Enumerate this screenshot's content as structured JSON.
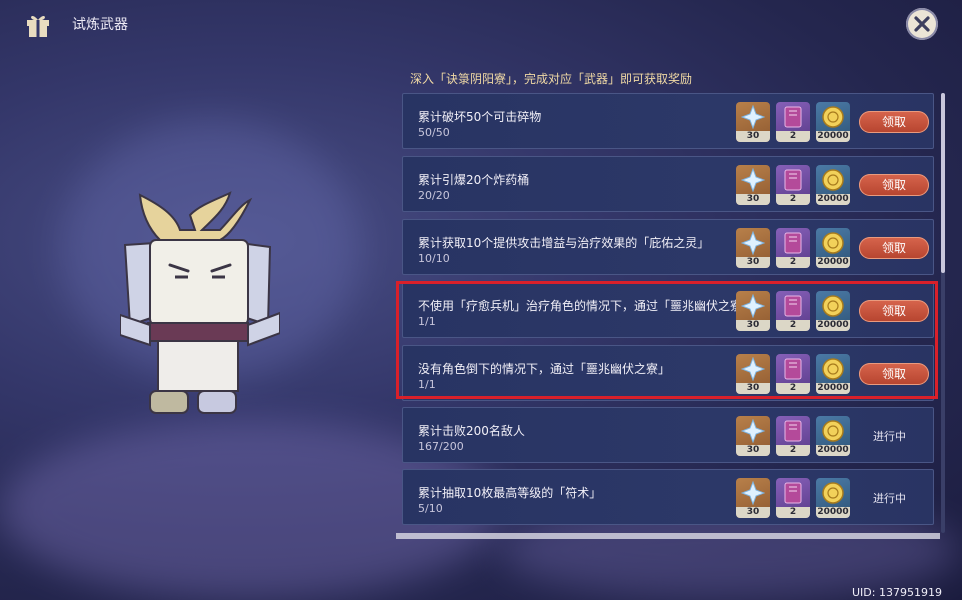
{
  "header": {
    "title": "试炼武器"
  },
  "subtitle": "深入「诀箓阴阳寮」，完成对应「武器」即可获取奖励",
  "tasks": [
    {
      "title": "累计破坏50个可击碎物",
      "progress": "50/50",
      "rewards": [
        "30",
        "2",
        "20000"
      ],
      "action": "领取"
    },
    {
      "title": "累计引爆20个炸药桶",
      "progress": "20/20",
      "rewards": [
        "30",
        "2",
        "20000"
      ],
      "action": "领取"
    },
    {
      "title": "累计获取10个提供攻击增益与治疗效果的「庇佑之灵」",
      "progress": "10/10",
      "rewards": [
        "30",
        "2",
        "20000"
      ],
      "action": "领取"
    },
    {
      "title": "不使用「疗愈兵机」治疗角色的情况下，通过「噩兆幽伏之寮」",
      "progress": "1/1",
      "rewards": [
        "30",
        "2",
        "20000"
      ],
      "action": "领取"
    },
    {
      "title": "没有角色倒下的情况下，通过「噩兆幽伏之寮」",
      "progress": "1/1",
      "rewards": [
        "30",
        "2",
        "20000"
      ],
      "action": "领取"
    },
    {
      "title": "累计击败200名敌人",
      "progress": "167/200",
      "rewards": [
        "30",
        "2",
        "20000"
      ],
      "action": "进行中"
    },
    {
      "title": "累计抽取10枚最高等级的「符术」",
      "progress": "5/10",
      "rewards": [
        "30",
        "2",
        "20000"
      ],
      "action": "进行中"
    }
  ],
  "reward_icons": [
    "primogem-icon",
    "book-icon",
    "mora-icon"
  ],
  "uid": "UID: 137951919",
  "colors": {
    "claim": "#c8543c",
    "highlight": "#d9202a",
    "panel": "#2a3665"
  }
}
